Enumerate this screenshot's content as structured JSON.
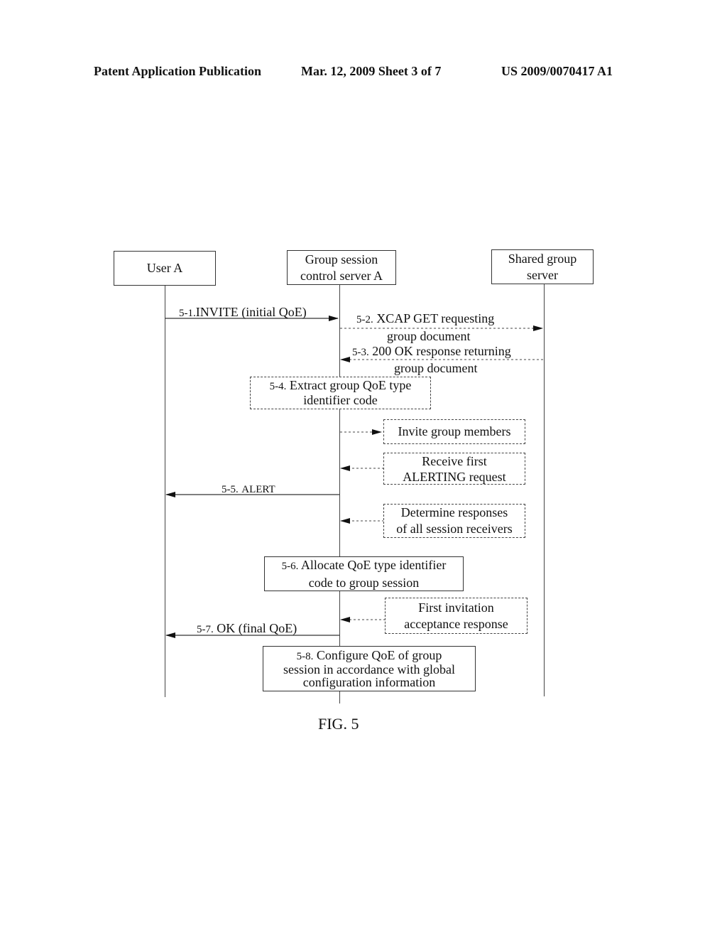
{
  "header": {
    "left": "Patent Application Publication",
    "center": "Mar. 12, 2009  Sheet 3 of 7",
    "right": "US 2009/0070417 A1"
  },
  "participants": [
    {
      "id": "user_a",
      "label": "User A"
    },
    {
      "id": "gscs_a",
      "label_lines": [
        "Group session",
        "control server A"
      ]
    },
    {
      "id": "shared",
      "label_lines": [
        "Shared group",
        "server"
      ]
    }
  ],
  "messages": [
    {
      "step": "5-1.",
      "text": "INVITE (initial QoE)",
      "from": "user_a",
      "to": "gscs_a",
      "style": "solid"
    },
    {
      "step": "5-2.",
      "text": "XCAP GET requesting",
      "text2": "group document",
      "from": "gscs_a",
      "to": "shared",
      "style": "dashed"
    },
    {
      "step": "5-3.",
      "text": "200 OK response returning",
      "text2": "group document",
      "from": "shared",
      "to": "gscs_a",
      "style": "dashed"
    },
    {
      "step": "5-5.",
      "text": "ALERT",
      "from": "gscs_a",
      "to": "user_a",
      "style": "solid"
    },
    {
      "step": "5-7.",
      "text": "OK (final QoE)",
      "from": "gscs_a",
      "to": "user_a",
      "style": "solid"
    }
  ],
  "process_boxes": [
    {
      "step": "5-4.",
      "line1": "Extract group QoE type",
      "line2": "identifier code",
      "style": "dashed"
    },
    {
      "step": "5-6.",
      "line1": "Allocate QoE type identifier",
      "line2": "code to group session",
      "style": "solid"
    },
    {
      "step": "5-8.",
      "line1": "Configure QoE of group",
      "line2": "session in accordance with global",
      "line3": "configuration information",
      "style": "solid"
    }
  ],
  "side_notes": [
    {
      "line1": "Invite group members",
      "direction": "outgoing"
    },
    {
      "line1": "Receive first",
      "line2": "ALERTING request",
      "direction": "incoming"
    },
    {
      "line1": "Determine responses",
      "line2": "of all session receivers",
      "direction": "incoming"
    },
    {
      "line1": "First invitation",
      "line2": "acceptance response",
      "direction": "incoming"
    }
  ],
  "figure_label": "FIG. 5"
}
